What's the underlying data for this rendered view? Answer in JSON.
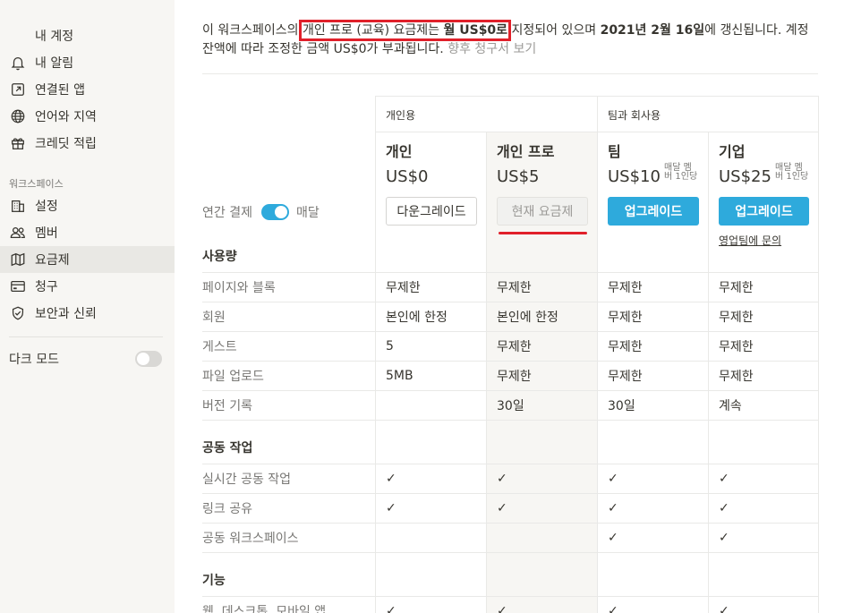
{
  "sidebar": {
    "account_items": [
      {
        "label": "내 계정",
        "icon": "account-icon"
      },
      {
        "label": "내 알림",
        "icon": "bell-icon"
      },
      {
        "label": "연결된 앱",
        "icon": "external-link-icon"
      },
      {
        "label": "언어와 지역",
        "icon": "globe-icon"
      },
      {
        "label": "크레딧 적립",
        "icon": "gift-icon"
      }
    ],
    "workspace_section": "워크스페이스",
    "workspace_items": [
      {
        "label": "설정",
        "icon": "building-icon"
      },
      {
        "label": "멤버",
        "icon": "people-icon"
      },
      {
        "label": "요금제",
        "icon": "map-icon",
        "active": true
      },
      {
        "label": "청구",
        "icon": "credit-card-icon"
      },
      {
        "label": "보안과 신뢰",
        "icon": "shield-check-icon"
      }
    ],
    "dark_mode_label": "다크 모드"
  },
  "notice": {
    "prefix": "이 워크스페이스의 ",
    "plan_text": "개인 프로 (교육) 요금제는 ",
    "price_text": "월 US$0로",
    "middle": " 지정되어 있으며 ",
    "renew_date": "2021년 2월 16일",
    "suffix": "에 갱신됩니다. 계정 잔액에 따라 조정한 금액 US$0가 부과됩니다. ",
    "link": "향후 청구서 보기"
  },
  "pricing": {
    "groups": {
      "personal": "개인용",
      "team": "팀과 회사용"
    },
    "billing": {
      "annual": "연간 결제",
      "monthly": "매달"
    },
    "plans": [
      {
        "name": "개인",
        "price": "US$0",
        "per_user": "",
        "button": "다운그레이드"
      },
      {
        "name": "개인 프로",
        "price": "US$5",
        "per_user": "",
        "button": "현재 요금제"
      },
      {
        "name": "팀",
        "price": "US$10",
        "per_user_l1": "매달 멤",
        "per_user_l2": "버 1인당",
        "button": "업그레이드"
      },
      {
        "name": "기업",
        "price": "US$25",
        "per_user_l1": "매달 멤",
        "per_user_l2": "버 1인당",
        "button": "업그레이드",
        "contact": "영업팀에 문의"
      }
    ],
    "sections": {
      "usage": "사용량",
      "collab": "공동 작업",
      "features": "기능"
    },
    "usage_rows": [
      {
        "label": "페이지와 블록",
        "values": [
          "무제한",
          "무제한",
          "무제한",
          "무제한"
        ]
      },
      {
        "label": "회원",
        "values": [
          "본인에 한정",
          "본인에 한정",
          "무제한",
          "무제한"
        ]
      },
      {
        "label": "게스트",
        "values": [
          "5",
          "무제한",
          "무제한",
          "무제한"
        ]
      },
      {
        "label": "파일 업로드",
        "values": [
          "5MB",
          "무제한",
          "무제한",
          "무제한"
        ]
      },
      {
        "label": "버전 기록",
        "values": [
          "",
          "30일",
          "30일",
          "계속"
        ]
      }
    ],
    "collab_rows": [
      {
        "label": "실시간 공동 작업",
        "values": [
          "✓",
          "✓",
          "✓",
          "✓"
        ]
      },
      {
        "label": "링크 공유",
        "values": [
          "✓",
          "✓",
          "✓",
          "✓"
        ]
      },
      {
        "label": "공동 워크스페이스",
        "values": [
          "",
          "",
          "✓",
          "✓"
        ]
      }
    ],
    "feature_rows": [
      {
        "label": "웹, 데스크톱, 모바일 앱",
        "values": [
          "✓",
          "✓",
          "✓",
          "✓"
        ]
      }
    ]
  },
  "colors": {
    "accent": "#2eaadc",
    "highlight": "#e0202a",
    "sidebar_bg": "#f7f6f3"
  }
}
